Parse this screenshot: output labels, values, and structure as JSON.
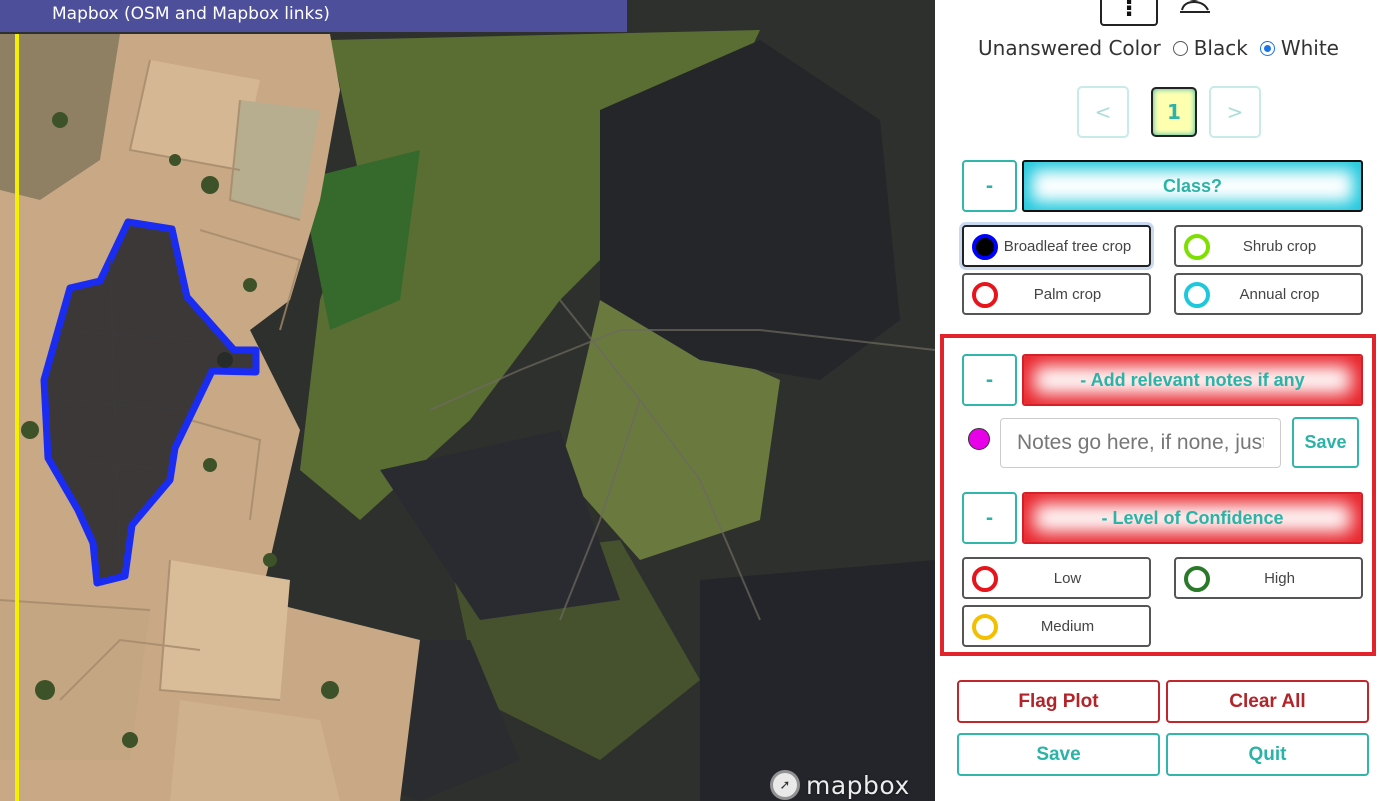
{
  "map": {
    "title": "Mapbox (OSM and Mapbox links)",
    "attribution": "mapbox",
    "plot_outline_color": "#1a2cf2",
    "edge_line_color": "#f5f000"
  },
  "panel": {
    "top_icons": [
      "info-icon",
      "user-icon"
    ],
    "info_glyph": "⁝",
    "unanswered": {
      "label": "Unanswered Color",
      "options": [
        {
          "label": "Black",
          "checked": false
        },
        {
          "label": "White",
          "checked": true
        }
      ]
    },
    "pager": {
      "prev": "<",
      "current": "1",
      "next": ">"
    },
    "collapse_label": "-",
    "class_question": {
      "title": "Class?",
      "options": [
        {
          "label": "Broadleaf tree crop",
          "color": "#0000ff",
          "fill": "#000000",
          "selected": true
        },
        {
          "label": "Shrub crop",
          "color": "#7ee000",
          "fill": "#ffffff",
          "selected": false
        },
        {
          "label": "Palm crop",
          "color": "#e8141c",
          "fill": "#ffffff",
          "selected": false
        },
        {
          "label": "Annual crop",
          "color": "#1ec8dc",
          "fill": "#ffffff",
          "selected": false
        }
      ]
    },
    "notes_question": {
      "title": "- Add relevant notes if any",
      "marker_color": "#e800e8",
      "placeholder": "Notes go here, if none, just click Save",
      "save_label": "Save"
    },
    "confidence_question": {
      "title": "- Level of Confidence",
      "options": [
        {
          "label": "Low",
          "color": "#e8141c"
        },
        {
          "label": "High",
          "color": "#2a7a2a"
        },
        {
          "label": "Medium",
          "color": "#f2c000"
        }
      ]
    },
    "actions": {
      "flag": "Flag Plot",
      "clear": "Clear All",
      "save": "Save",
      "quit": "Quit"
    }
  }
}
